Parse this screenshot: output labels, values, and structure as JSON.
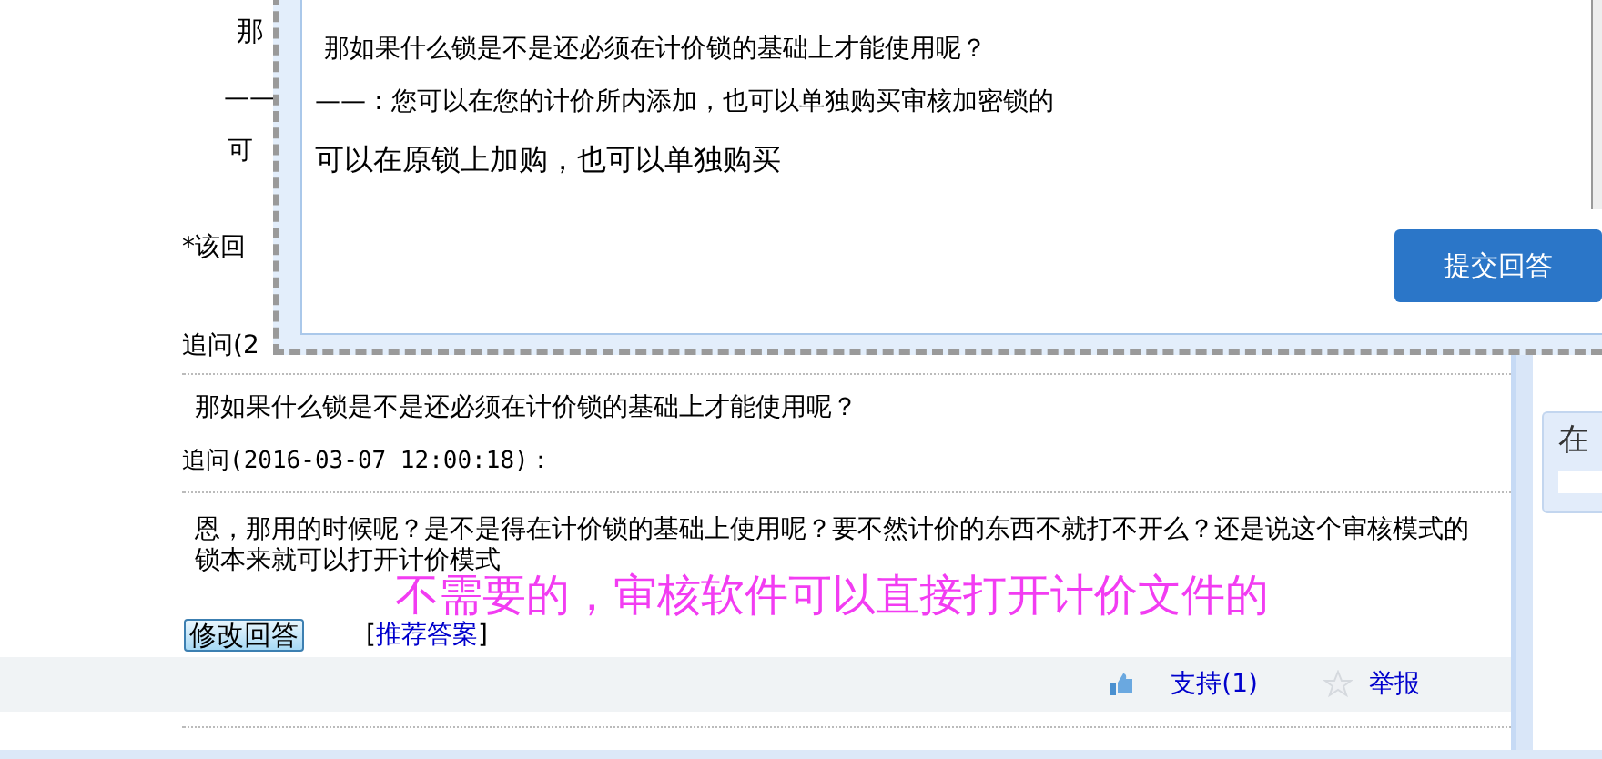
{
  "background_fragments": [
    {
      "text": "那"
    },
    {
      "text": "——"
    },
    {
      "text": "可"
    },
    {
      "text": "*该回"
    },
    {
      "text": "追问(2"
    }
  ],
  "dialog": {
    "lines": [
      "那如果什么锁是不是还必须在计价锁的基础上才能使用呢？",
      "——：您可以在您的计价所内添加，也可以单独购买审核加密锁的",
      "可以在原锁上加购，也可以单独购买"
    ],
    "submit_button": "提交回答"
  },
  "question_text": "那如果什么锁是不是还必须在计价锁的基础上才能使用呢？",
  "followup": {
    "label": "追问(2016-03-07 12:00:18)：",
    "text": "恩，那用的时候呢？是不是得在计价锁的基础上使用呢？要不然计价的东西不就打不开么？还是说这个审核模式的锁本来就可以打开计价模式"
  },
  "annotation": "不需要的，审核软件可以直接打开计价文件的",
  "actions": {
    "edit_button": "修改回答",
    "recommend": {
      "open": "[",
      "link": "推荐答案",
      "close": "]"
    }
  },
  "footer": {
    "support": "支持(1)",
    "report": "举报"
  },
  "sidebar": {
    "heading": "在"
  }
}
